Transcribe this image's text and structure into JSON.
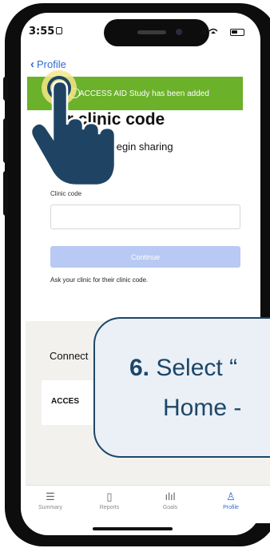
{
  "status_bar": {
    "time": "3:55"
  },
  "nav": {
    "back_label": "Profile"
  },
  "toast": {
    "message": "ACCESS AID Study has been added"
  },
  "page": {
    "heading": "er clinic code",
    "subtext": "nic code to begin sharing"
  },
  "form": {
    "clinic_code_label": "Clinic code",
    "clinic_code_value": "",
    "continue_label": "Continue",
    "help_text": "Ask your clinic for their clinic code."
  },
  "connections": {
    "label": "Connect",
    "item_label": "ACCES"
  },
  "tabs": [
    {
      "label": "Summary",
      "icon": "list-icon",
      "glyph": "☰"
    },
    {
      "label": "Reports",
      "icon": "document-icon",
      "glyph": "▯"
    },
    {
      "label": "Goals",
      "icon": "bar-chart-icon",
      "glyph": "ılıl"
    },
    {
      "label": "Profile",
      "icon": "person-icon",
      "glyph": "♙",
      "active": true
    }
  ],
  "callout": {
    "step_number": "6.",
    "line1_text": " Select “",
    "line2_text": "Home -"
  },
  "colors": {
    "accent": "#2f6bd6",
    "toast_green": "#6bb12a",
    "callout_navy": "#1d4668",
    "continue_disabled": "#b8c9f3"
  }
}
